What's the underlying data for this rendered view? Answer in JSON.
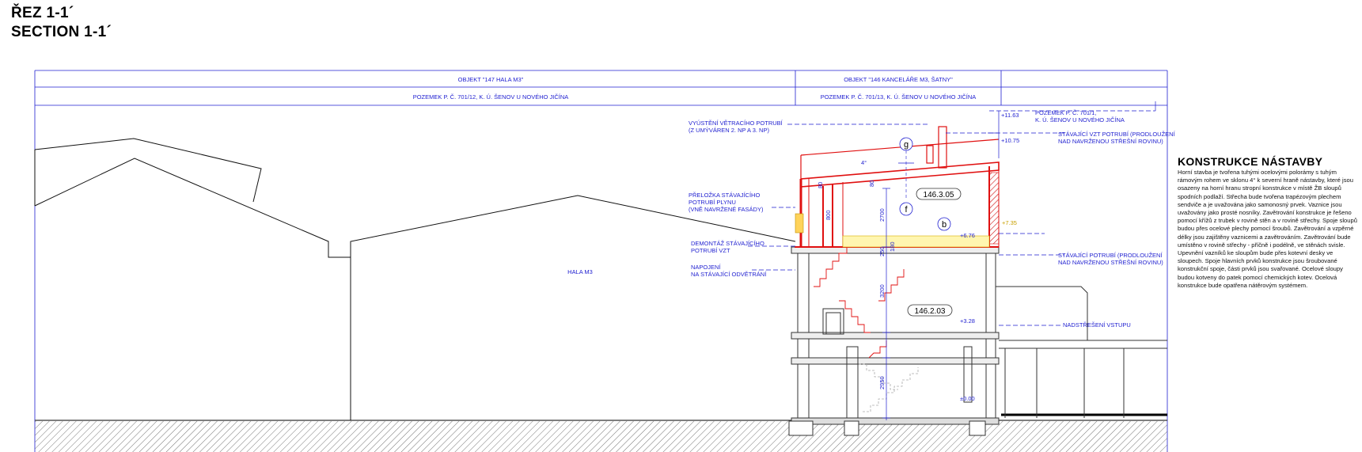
{
  "title": {
    "cz": "ŘEZ 1-1´",
    "en": "SECTION 1-1´"
  },
  "table": {
    "row1": {
      "left": "OBJEKT \"147 HALA M3\"",
      "right": "OBJEKT \"146 KANCELÁŘE M3, ŠATNY\""
    },
    "row2": {
      "left": "POZEMEK P. Č. 701/12, K. Ú. ŠENOV U NOVÉHO JIČÍNA",
      "right": "POZEMEK P. Č. 701/13, K. Ú. ŠENOV U NOVÉHO JIČÍNA"
    }
  },
  "hall_label": "HALA M3",
  "annotations": {
    "vent_1": "VYÚSTĚNÍ VĚTRACÍHO POTRUBÍ",
    "vent_2": "(Z UMÝVÁREN 2. NP A 3. NP)",
    "gas_1": "PŘELOŽKA STÁVAJÍCÍHO",
    "gas_2": "POTRUBÍ PLYNU",
    "gas_3": "(VNĚ NAVRŽENÉ FASÁDY)",
    "vzt_1": "DEMONTÁŽ STÁVAJÍCÍHO",
    "vzt_2": "POTRUBÍ VZT",
    "con_1": "NAPOJENÍ",
    "con_2": "NA STÁVAJÍCÍ ODVĚTRÁNÍ",
    "plot_1": "POZEMEK P. Č. 701/1,",
    "plot_2": "K. Ú. ŠENOV U NOVÉHO JIČÍNA",
    "ext_1": "STÁVAJÍCÍ VZT POTRUBÍ (PRODLOUŽENÍ",
    "ext_2": "NAD NAVRŽENOU STŘEŠNÍ ROVINU)",
    "ext2_1": "STÁVAJÍCÍ POTRUBÍ (PRODLOUŽENÍ",
    "ext2_2": "NAD NAVRŽENOU STŘEŠNÍ ROVINU)",
    "canopy": "NADSTŘEŠENÍ VSTUPU"
  },
  "levels": {
    "l1": "+11.63",
    "l2": "+10.75",
    "l3": "+7.35",
    "l4": "+6.76",
    "l5": "+3.28",
    "l6": "±0.00"
  },
  "dimensions": {
    "d1": "2700",
    "d2": "3200",
    "d3": "2950",
    "d4": "800",
    "d5": "250",
    "d6": "80",
    "d7": "80",
    "d8": "180",
    "angle": "4°"
  },
  "grid": {
    "g": "g",
    "f": "f",
    "b": "b"
  },
  "rooms": {
    "r1": "146.3.05",
    "r2": "146.2.03"
  },
  "notes": {
    "heading": "KONSTRUKCE NÁSTAVBY",
    "text": "Horní stavba je tvořena tuhými ocelovými polorámy s tuhým rámovým rohem ve sklonu 4° k severní hraně nástavby, které jsou osazeny na horní hranu stropní konstrukce v místě ŽB sloupů spodních podlaží. Střecha bude tvořena trapézovým plechem sendviče a je uvažována jako samonosný prvek. Vaznice jsou uvažovány jako prosté nosníky. Zavětrování konstrukce je řešeno pomocí křížů z trubek v rovině stěn a v rovině střechy. Spoje sloupů budou přes ocelové plechy pomocí šroubů. Zavětrování a vzpěrné délky jsou zajištěny vaznicemi a zavětrováním. Zavětrování bude umístěno v rovině střechy - příčně i podélně, ve stěnách svisle. Upevnění vazníků ke sloupům bude přes kotevní desky ve sloupech. Spoje hlavních prvků konstrukce jsou šroubované konstrukční spoje, části prvků jsou svařované. Ocelové sloupy budou kotveny do patek pomocí chemických kotev. Ocelová konstrukce bude opatřena nátěrovým systémem."
  },
  "colors": {
    "line": "#1f1fd0",
    "new": "#e01010",
    "ground": "#777777"
  }
}
